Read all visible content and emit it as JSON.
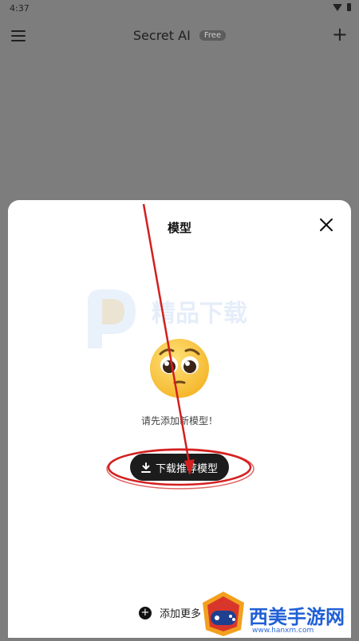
{
  "status_bar": {
    "time": "4:37",
    "icons": [
      "wifi-icon",
      "battery-icon"
    ]
  },
  "app_bar": {
    "title": "Secret AI",
    "badge": "Free",
    "menu_icon": "hamburger-menu-icon",
    "add_icon": "plus-icon",
    "add_label": "+"
  },
  "sheet": {
    "title": "模型",
    "close_icon": "close-icon",
    "empty_emoji": "pleading-face-emoji",
    "hint": "请先添加新模型！",
    "download_button": "下载推荐模型",
    "add_more": "添加更多",
    "add_more_icon": "+"
  },
  "watermark": {
    "text": "精品下载"
  },
  "corner_logo": {
    "text": "西美手游网",
    "url": "www.hanxm.com"
  },
  "colors": {
    "overlay": "#7d7d7d",
    "sheet": "#ffffff",
    "button": "#1c1c1c",
    "annotation": "#d41f1f"
  }
}
